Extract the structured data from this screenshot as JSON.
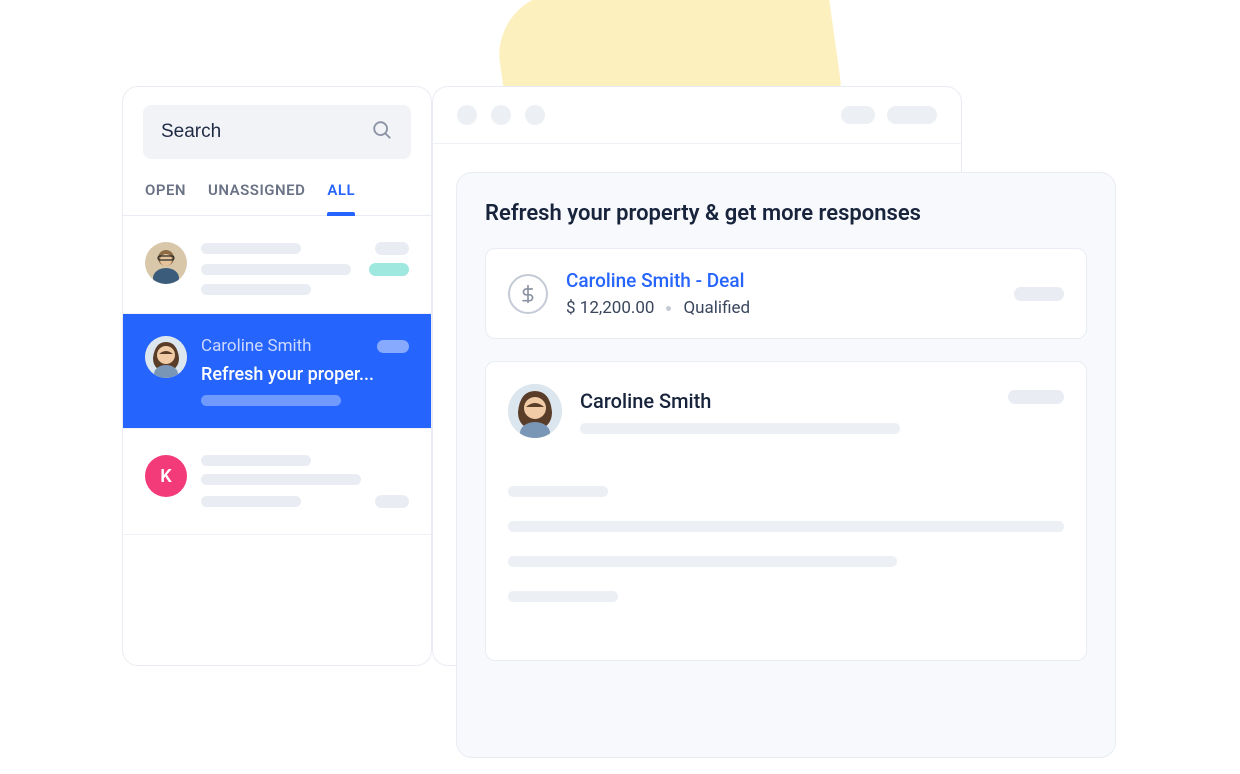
{
  "search": {
    "placeholder": "Search"
  },
  "tabs": {
    "open": "OPEN",
    "unassigned": "UNASSIGNED",
    "all": "ALL"
  },
  "conversations": {
    "item0": {
      "avatarInitial": ""
    },
    "item1": {
      "name": "Caroline Smith",
      "subject": "Refresh your proper..."
    },
    "item2": {
      "avatarInitial": "K"
    }
  },
  "detail": {
    "title": "Refresh your property & get more responses",
    "deal": {
      "title": "Caroline Smith - Deal",
      "amount": "$ 12,200.00",
      "status": "Qualified"
    },
    "message": {
      "sender": "Caroline Smith"
    }
  }
}
